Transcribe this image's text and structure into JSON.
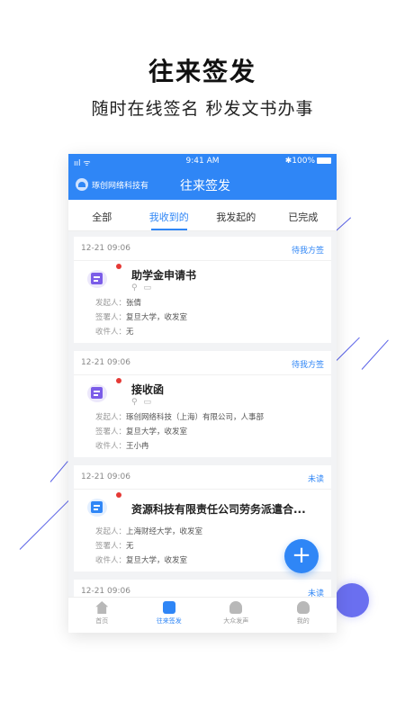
{
  "hero": {
    "title": "往来签发",
    "subtitle": "随时在线签名  秒发文书办事"
  },
  "status_bar": {
    "signal": "ııl ᯤ",
    "time": "9:41 AM",
    "battery": "✱100%"
  },
  "nav": {
    "org_name": "琢创网络科技有",
    "title": "往来签发"
  },
  "tabs": [
    {
      "label": "全部"
    },
    {
      "label": "我收到的"
    },
    {
      "label": "我发起的"
    },
    {
      "label": "已完成"
    }
  ],
  "labels": {
    "initiator": "发起人：",
    "signer": "签署人：",
    "receiver": "收件人："
  },
  "cards": [
    {
      "time": "12-21 09:06",
      "status": "待我方签",
      "title": "助学金申请书",
      "icons": "⚲ ▭",
      "initiator": "张倩",
      "signer": "复旦大学，收发室",
      "receiver": "无",
      "icon_color": "#7b5ce8"
    },
    {
      "time": "12-21 09:06",
      "status": "待我方签",
      "title": "接收函",
      "icons": "⚲ ▭",
      "initiator": "琢创网络科技（上海）有限公司，人事部",
      "signer": "复旦大学，收发室",
      "receiver": "王小冉",
      "icon_color": "#7b5ce8"
    },
    {
      "time": "12-21 09:06",
      "status": "未读",
      "title": "资源科技有限责任公司劳务派遣合...",
      "icons": "",
      "initiator": "上海财经大学，收发室",
      "signer": "无",
      "receiver": "复旦大学，收发室",
      "icon_color": "#2f86f6"
    },
    {
      "time": "12-21 09:06",
      "status": "未读"
    }
  ],
  "fab": {
    "label": "+"
  },
  "bottom_nav": [
    {
      "label": "首页",
      "icon": "home-icon"
    },
    {
      "label": "往来签发",
      "icon": "inbox-icon"
    },
    {
      "label": "大众发声",
      "icon": "users-icon"
    },
    {
      "label": "我的",
      "icon": "person-icon"
    }
  ],
  "colors": {
    "accent": "#2f86f6",
    "unread_dot": "#e53935",
    "doc_purple": "#7b5ce8",
    "deco": "#5b63e8"
  }
}
